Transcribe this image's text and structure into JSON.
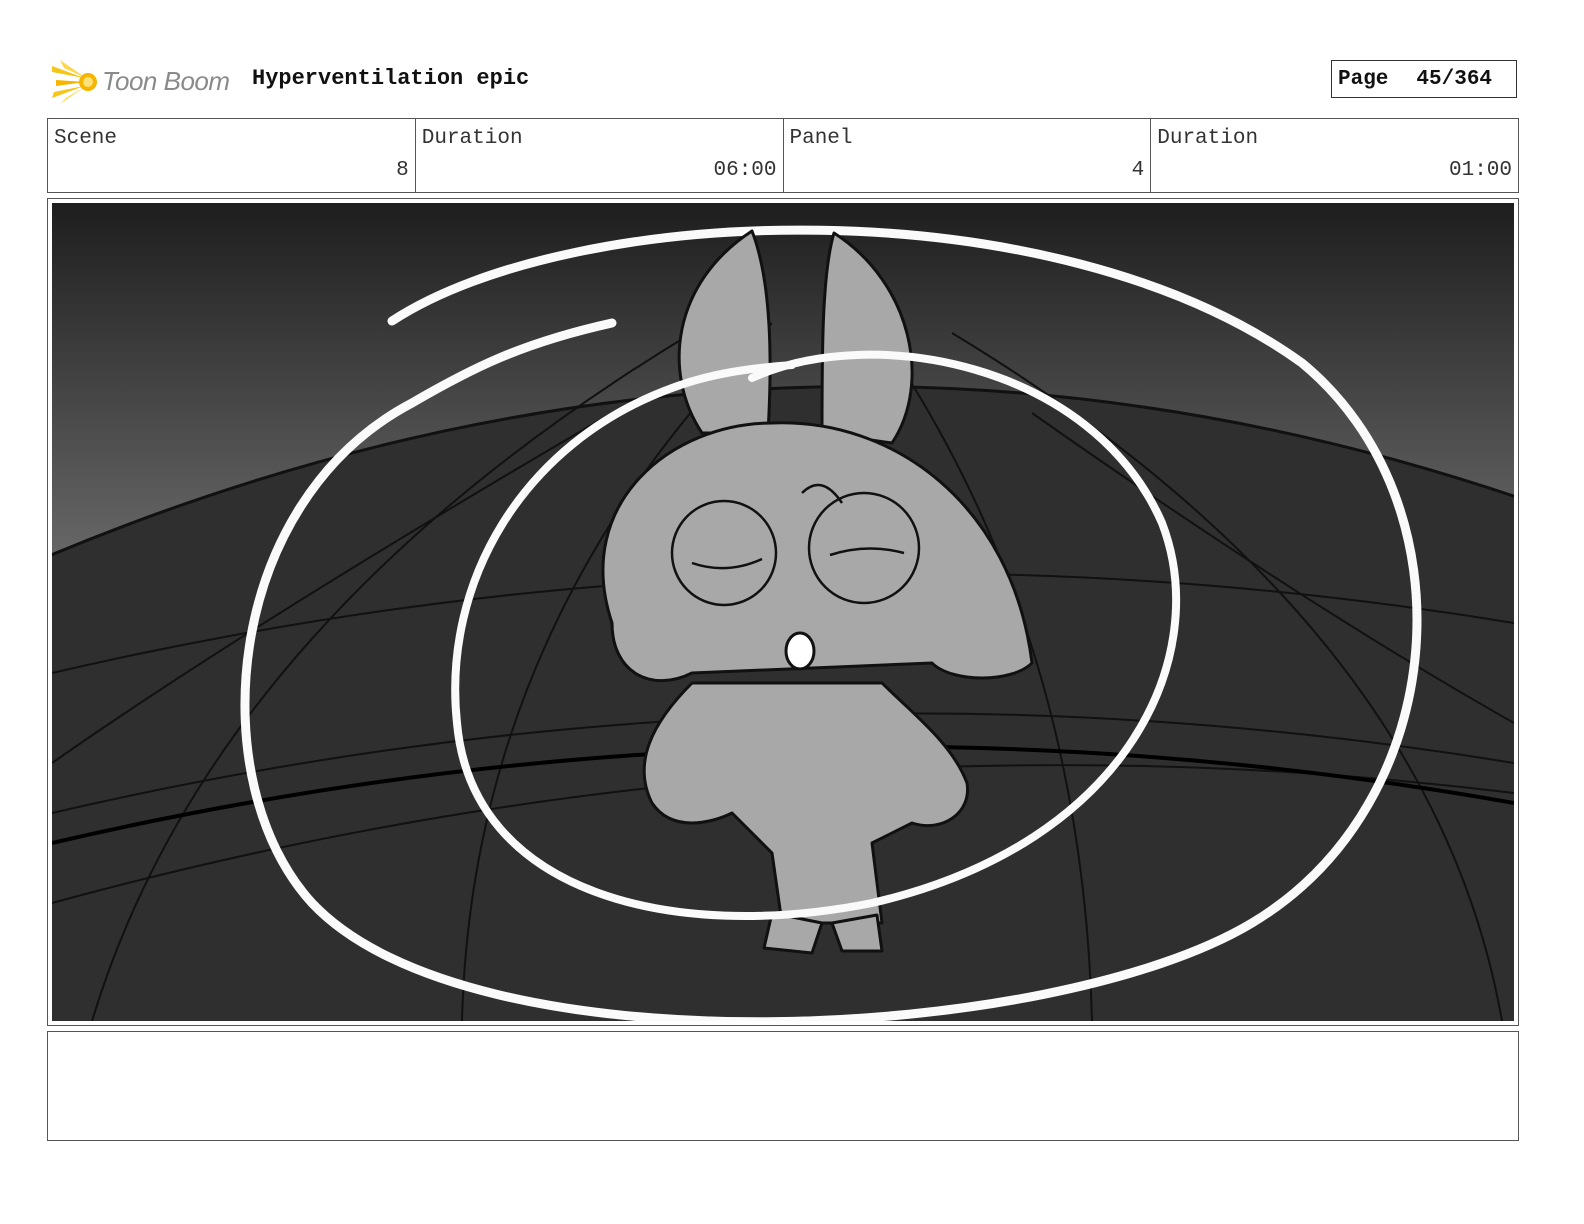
{
  "header": {
    "logo_text": "Toon Boom",
    "project_title": "Hyperventilation epic",
    "page_label": "Page",
    "page_number": "45/364"
  },
  "info": {
    "scene_label": "Scene",
    "scene_value": "8",
    "scene_duration_label": "Duration",
    "scene_duration_value": "06:00",
    "panel_label": "Panel",
    "panel_value": "4",
    "panel_duration_label": "Duration",
    "panel_duration_value": "01:00"
  },
  "panel": {
    "image": "storyboard-sketch"
  },
  "notes": {
    "text": ""
  },
  "colors": {
    "logo_accent": "#f5c518",
    "logo_text": "#8a8a8a",
    "border": "#555555"
  }
}
